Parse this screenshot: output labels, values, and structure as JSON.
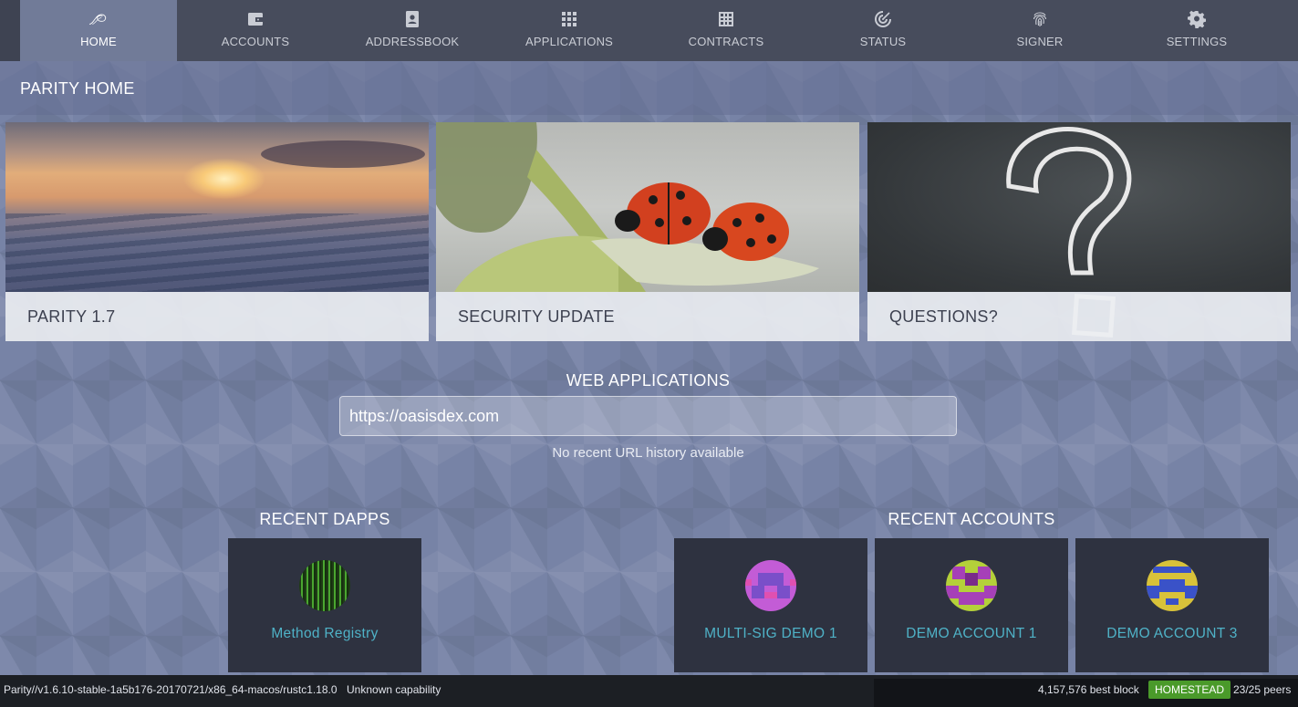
{
  "nav": {
    "tabs": [
      {
        "label": "HOME",
        "icon": "parity-logo-icon",
        "active": true
      },
      {
        "label": "ACCOUNTS",
        "icon": "wallet-icon"
      },
      {
        "label": "ADDRESSBOOK",
        "icon": "contacts-icon"
      },
      {
        "label": "APPLICATIONS",
        "icon": "apps-grid-icon"
      },
      {
        "label": "CONTRACTS",
        "icon": "table-grid-icon"
      },
      {
        "label": "STATUS",
        "icon": "radar-icon"
      },
      {
        "label": "SIGNER",
        "icon": "fingerprint-icon"
      },
      {
        "label": "SETTINGS",
        "icon": "gear-icon"
      }
    ]
  },
  "page": {
    "title": "PARITY HOME"
  },
  "news": [
    {
      "caption": "PARITY 1.7"
    },
    {
      "caption": "SECURITY UPDATE"
    },
    {
      "caption": "QUESTIONS?"
    }
  ],
  "web_apps": {
    "title": "WEB APPLICATIONS",
    "url_value": "https://oasisdex.com",
    "history_note": "No recent URL history available"
  },
  "recent_dapps": {
    "title": "RECENT DAPPS",
    "items": [
      {
        "label": "Method Registry"
      }
    ]
  },
  "recent_accounts": {
    "title": "RECENT ACCOUNTS",
    "items": [
      {
        "label": "MULTI-SIG DEMO 1"
      },
      {
        "label": "DEMO ACCOUNT 1"
      },
      {
        "label": "DEMO ACCOUNT 3"
      }
    ]
  },
  "status_bar": {
    "version": "Parity//v1.6.10-stable-1a5b176-20170721/x86_64-macos/rustc1.18.0",
    "capability": "Unknown capability",
    "best_block": "4,157,576 best block",
    "chain": "HOMESTEAD",
    "peers": "23/25 peers"
  },
  "colors": {
    "nav_bg": "#474c5c",
    "active_tab": "#717b98",
    "accent_link": "#4fb2c7",
    "chain_badge": "#4a9a2a"
  }
}
